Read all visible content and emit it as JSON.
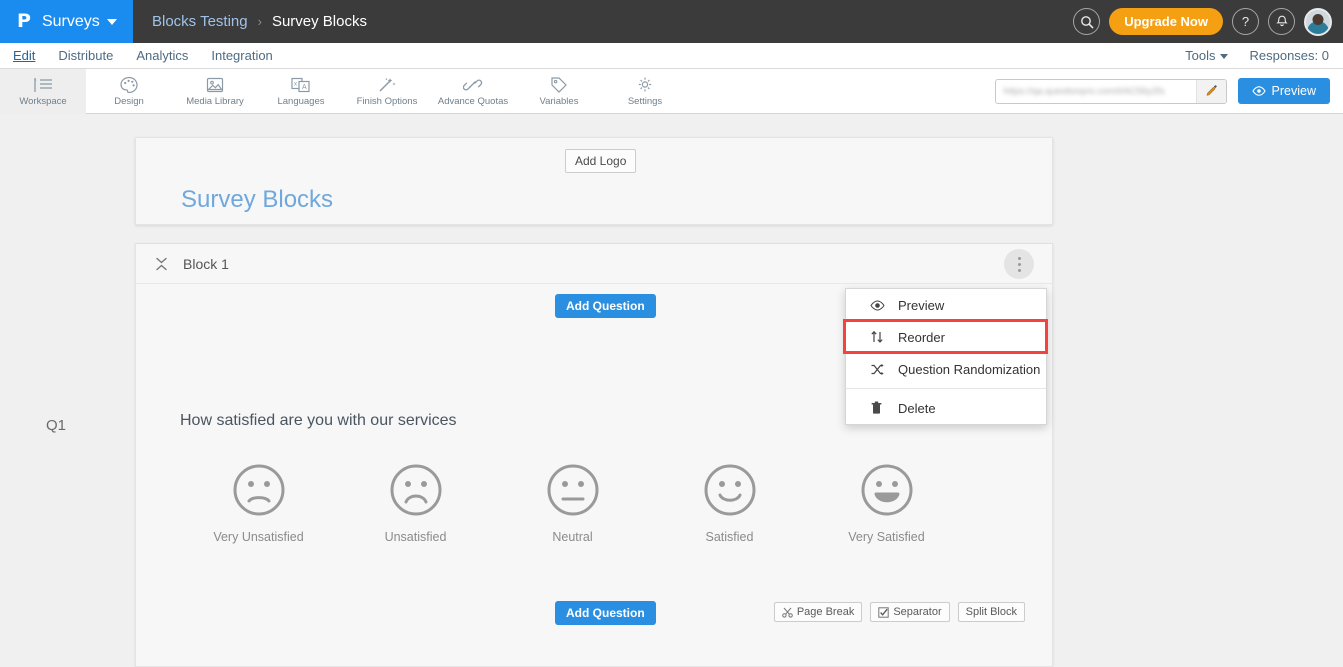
{
  "topbar": {
    "brand_logo": "P",
    "brand_label": "Surveys",
    "breadcrumb_parent": "Blocks Testing",
    "breadcrumb_separator": "›",
    "breadcrumb_current": "Survey Blocks",
    "search_icon": "search-icon",
    "upgrade_label": "Upgrade Now",
    "help_icon": "?",
    "bell_icon": "🔔",
    "avatar": "user-avatar"
  },
  "nav": {
    "tabs": [
      {
        "label": "Edit",
        "active": true
      },
      {
        "label": "Distribute",
        "active": false
      },
      {
        "label": "Analytics",
        "active": false
      },
      {
        "label": "Integration",
        "active": false
      }
    ],
    "tools_label": "Tools",
    "responses_label": "Responses: 0"
  },
  "toolbar": {
    "items": [
      {
        "label": "Workspace",
        "icon": "workspace-icon",
        "active": true
      },
      {
        "label": "Design",
        "icon": "palette-icon",
        "active": false
      },
      {
        "label": "Media Library",
        "icon": "image-icon",
        "active": false
      },
      {
        "label": "Languages",
        "icon": "translate-icon",
        "active": false
      },
      {
        "label": "Finish Options",
        "icon": "magic-wand-icon",
        "active": false
      },
      {
        "label": "Advance Quotas",
        "icon": "link-icon",
        "active": false
      },
      {
        "label": "Variables",
        "icon": "tag-icon",
        "active": false
      },
      {
        "label": "Settings",
        "icon": "gear-icon",
        "active": false
      }
    ],
    "url_value": "https://qa.questionpro.com/t/AC56y2fs",
    "url_edit_icon": "pencil-icon",
    "preview_label": "Preview",
    "preview_icon": "eye-icon"
  },
  "survey": {
    "add_logo_label": "Add Logo",
    "title": "Survey Blocks"
  },
  "block": {
    "collapse_icon": "collapse-icon",
    "title": "Block 1",
    "kebab_icon": "more-vertical-icon",
    "add_question_top": "Add Question",
    "add_question_bottom": "Add Question",
    "footer_buttons": [
      {
        "label": "Page Break",
        "icon": "scissors-icon"
      },
      {
        "label": "Separator",
        "icon": "checkbox-icon"
      },
      {
        "label": "Split Block",
        "icon": ""
      }
    ]
  },
  "question": {
    "number": "Q1",
    "text": "How satisfied are you with our services",
    "options": [
      {
        "label": "Very Unsatisfied",
        "face": "slight-frown-face-icon"
      },
      {
        "label": "Unsatisfied",
        "face": "frown-face-icon"
      },
      {
        "label": "Neutral",
        "face": "neutral-face-icon"
      },
      {
        "label": "Satisfied",
        "face": "smile-face-icon"
      },
      {
        "label": "Very Satisfied",
        "face": "big-smile-face-icon"
      }
    ]
  },
  "dropdown": {
    "items": [
      {
        "label": "Preview",
        "icon": "eye-icon",
        "highlighted": false
      },
      {
        "label": "Reorder",
        "icon": "sort-arrows-icon",
        "highlighted": true
      },
      {
        "label": "Question Randomization",
        "icon": "shuffle-icon",
        "highlighted": false
      },
      {
        "label": "Delete",
        "icon": "trash-icon",
        "highlighted": false
      }
    ]
  },
  "colors": {
    "brand_blue": "#1a8cf0",
    "topbar_dark": "#3b3b3b",
    "accent_orange": "#f5a012",
    "primary_button": "#2a8fe0",
    "highlight_red": "#f4433c",
    "title_blue": "#6fa8dc",
    "canvas_gray": "#f0f0f0"
  }
}
